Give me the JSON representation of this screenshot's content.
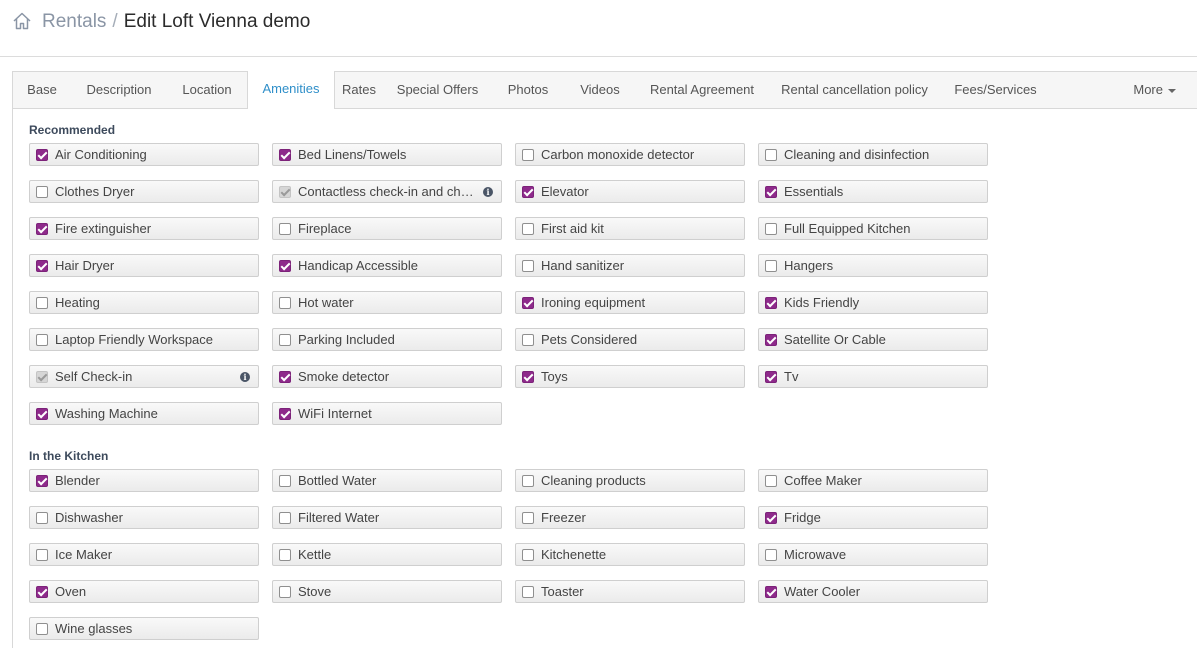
{
  "breadcrumb": {
    "root": "Rentals",
    "separator": "/",
    "current": "Edit Loft Vienna demo"
  },
  "tabs": [
    "Base",
    "Description",
    "Location",
    "Amenities",
    "Rates",
    "Special Offers",
    "Photos",
    "Videos",
    "Rental Agreement",
    "Rental cancellation policy",
    "Fees/Services"
  ],
  "active_tab": "Amenities",
  "more_label": "More",
  "colors": {
    "checked": "#8e2a8b",
    "active_tab": "#2f8fc9"
  },
  "sections": [
    {
      "title": "Recommended",
      "items": [
        {
          "label": "Air Conditioning",
          "state": "checked"
        },
        {
          "label": "Bed Linens/Towels",
          "state": "checked"
        },
        {
          "label": "Carbon monoxide detector",
          "state": "unchecked"
        },
        {
          "label": "Cleaning and disinfection",
          "state": "unchecked"
        },
        {
          "label": "Clothes Dryer",
          "state": "unchecked"
        },
        {
          "label": "Contactless check-in and chec…",
          "state": "disabled",
          "info": true
        },
        {
          "label": "Elevator",
          "state": "checked"
        },
        {
          "label": "Essentials",
          "state": "checked"
        },
        {
          "label": "Fire extinguisher",
          "state": "checked"
        },
        {
          "label": "Fireplace",
          "state": "unchecked"
        },
        {
          "label": "First aid kit",
          "state": "unchecked"
        },
        {
          "label": "Full Equipped Kitchen",
          "state": "unchecked"
        },
        {
          "label": "Hair Dryer",
          "state": "checked"
        },
        {
          "label": "Handicap Accessible",
          "state": "checked"
        },
        {
          "label": "Hand sanitizer",
          "state": "unchecked"
        },
        {
          "label": "Hangers",
          "state": "unchecked"
        },
        {
          "label": "Heating",
          "state": "unchecked"
        },
        {
          "label": "Hot water",
          "state": "unchecked"
        },
        {
          "label": "Ironing equipment",
          "state": "checked"
        },
        {
          "label": "Kids Friendly",
          "state": "checked"
        },
        {
          "label": "Laptop Friendly Workspace",
          "state": "unchecked"
        },
        {
          "label": "Parking Included",
          "state": "unchecked"
        },
        {
          "label": "Pets Considered",
          "state": "unchecked"
        },
        {
          "label": "Satellite Or Cable",
          "state": "checked"
        },
        {
          "label": "Self Check-in",
          "state": "disabled",
          "info": true
        },
        {
          "label": "Smoke detector",
          "state": "checked"
        },
        {
          "label": "Toys",
          "state": "checked"
        },
        {
          "label": "Tv",
          "state": "checked"
        },
        {
          "label": "Washing Machine",
          "state": "checked"
        },
        {
          "label": "WiFi Internet",
          "state": "checked"
        }
      ]
    },
    {
      "title": "In the Kitchen",
      "items": [
        {
          "label": "Blender",
          "state": "checked"
        },
        {
          "label": "Bottled Water",
          "state": "unchecked"
        },
        {
          "label": "Cleaning products",
          "state": "unchecked"
        },
        {
          "label": "Coffee Maker",
          "state": "unchecked"
        },
        {
          "label": "Dishwasher",
          "state": "unchecked"
        },
        {
          "label": "Filtered Water",
          "state": "unchecked"
        },
        {
          "label": "Freezer",
          "state": "unchecked"
        },
        {
          "label": "Fridge",
          "state": "checked"
        },
        {
          "label": "Ice Maker",
          "state": "unchecked"
        },
        {
          "label": "Kettle",
          "state": "unchecked"
        },
        {
          "label": "Kitchenette",
          "state": "unchecked"
        },
        {
          "label": "Microwave",
          "state": "unchecked"
        },
        {
          "label": "Oven",
          "state": "checked"
        },
        {
          "label": "Stove",
          "state": "unchecked"
        },
        {
          "label": "Toaster",
          "state": "unchecked"
        },
        {
          "label": "Water Cooler",
          "state": "checked"
        },
        {
          "label": "Wine glasses",
          "state": "unchecked"
        }
      ]
    }
  ]
}
